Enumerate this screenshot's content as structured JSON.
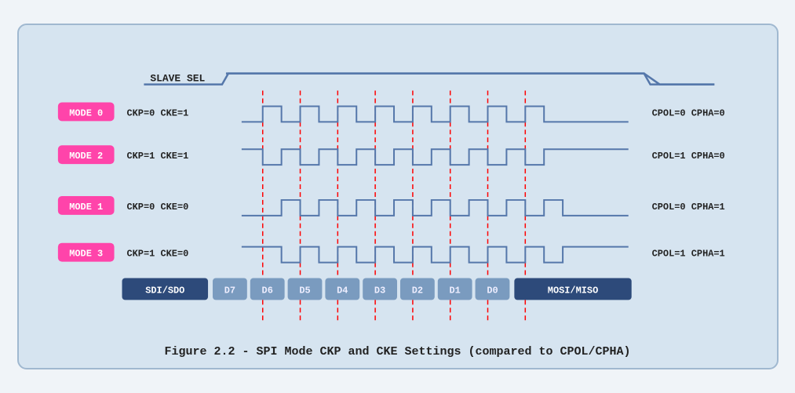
{
  "caption": "Figure 2.2 - SPI Mode CKP and CKE Settings (compared to CPOL/CPHA)",
  "diagram": {
    "slave_sel_label": "SLAVE SEL",
    "modes": [
      {
        "label": "MODE 0",
        "params": "CKP=0  CKE=1",
        "right": "CPOL=0  CPHA=0"
      },
      {
        "label": "MODE 2",
        "params": "CKP=1  CKE=1",
        "right": "CPOL=1  CPHA=0"
      },
      {
        "label": "MODE 1",
        "params": "CKP=0  CKE=0",
        "right": "CPOL=0  CPHA=1"
      },
      {
        "label": "MODE 3",
        "params": "CKP=1  CKE=0",
        "right": "CPOL=1  CPHA=1"
      }
    ],
    "data_labels": [
      "SDI/SDO",
      "D7",
      "D6",
      "D5",
      "D4",
      "D3",
      "D2",
      "D1",
      "D0",
      "MOSI/MISO"
    ]
  }
}
